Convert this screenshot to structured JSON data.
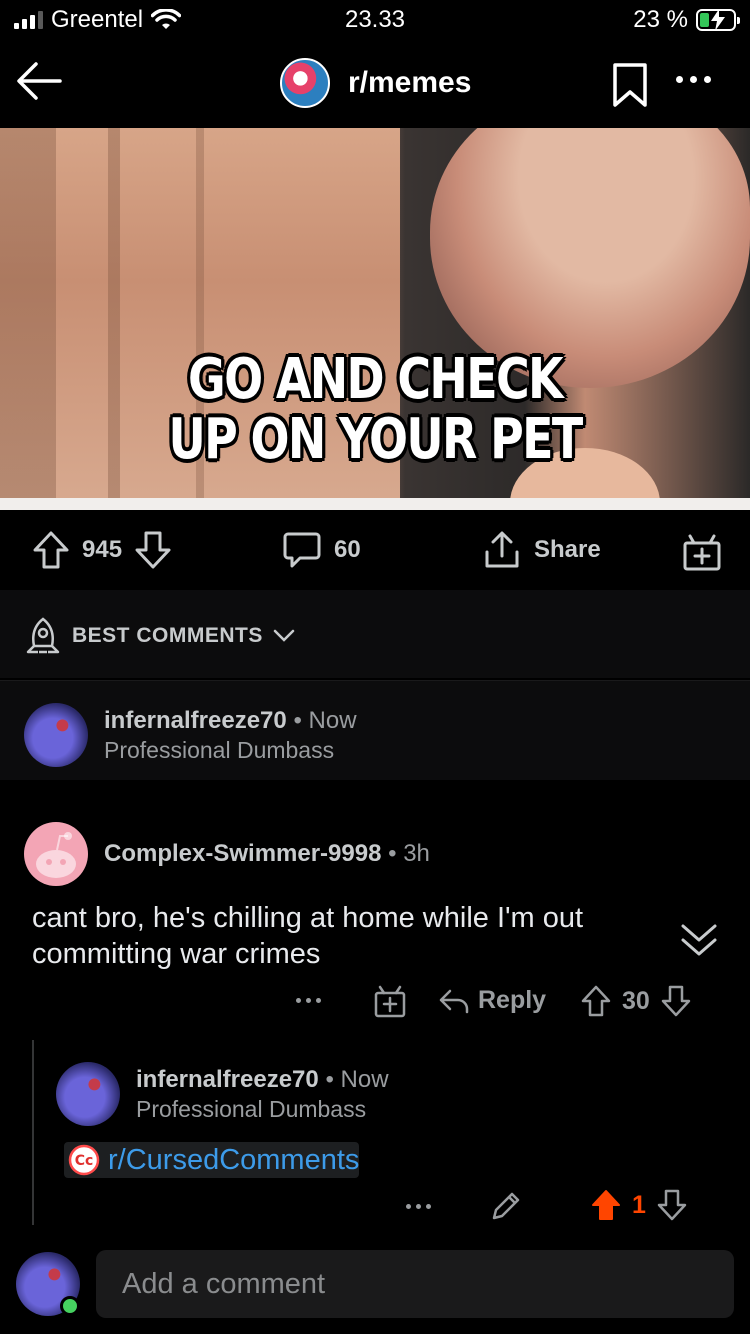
{
  "status": {
    "carrier": "Greentel",
    "time": "23.33",
    "battery": "23 %"
  },
  "nav": {
    "subreddit": "r/memes"
  },
  "post": {
    "caption_line1": "GO AND CHECK",
    "caption_line2": "UP ON YOUR PET",
    "votes": "945",
    "comments": "60",
    "share": "Share"
  },
  "sort": {
    "label": "BEST COMMENTS"
  },
  "comments": [
    {
      "user": "infernalfreeze70",
      "time": "Now",
      "flair": "Professional Dumbass"
    },
    {
      "user": "Complex-Swimmer-9998",
      "time": "3h",
      "body": "cant bro, he's chilling at home while I'm out committing war crimes",
      "reply_label": "Reply",
      "votes": "30",
      "replies": [
        {
          "user": "infernalfreeze70",
          "time": "Now",
          "flair": "Professional Dumbass",
          "link": "r/CursedComments",
          "votes": "1"
        }
      ]
    }
  ],
  "composer": {
    "placeholder": "Add a comment"
  },
  "colors": {
    "accent_link": "#3d9be9",
    "upvote": "#ff4500",
    "online": "#46d160"
  }
}
